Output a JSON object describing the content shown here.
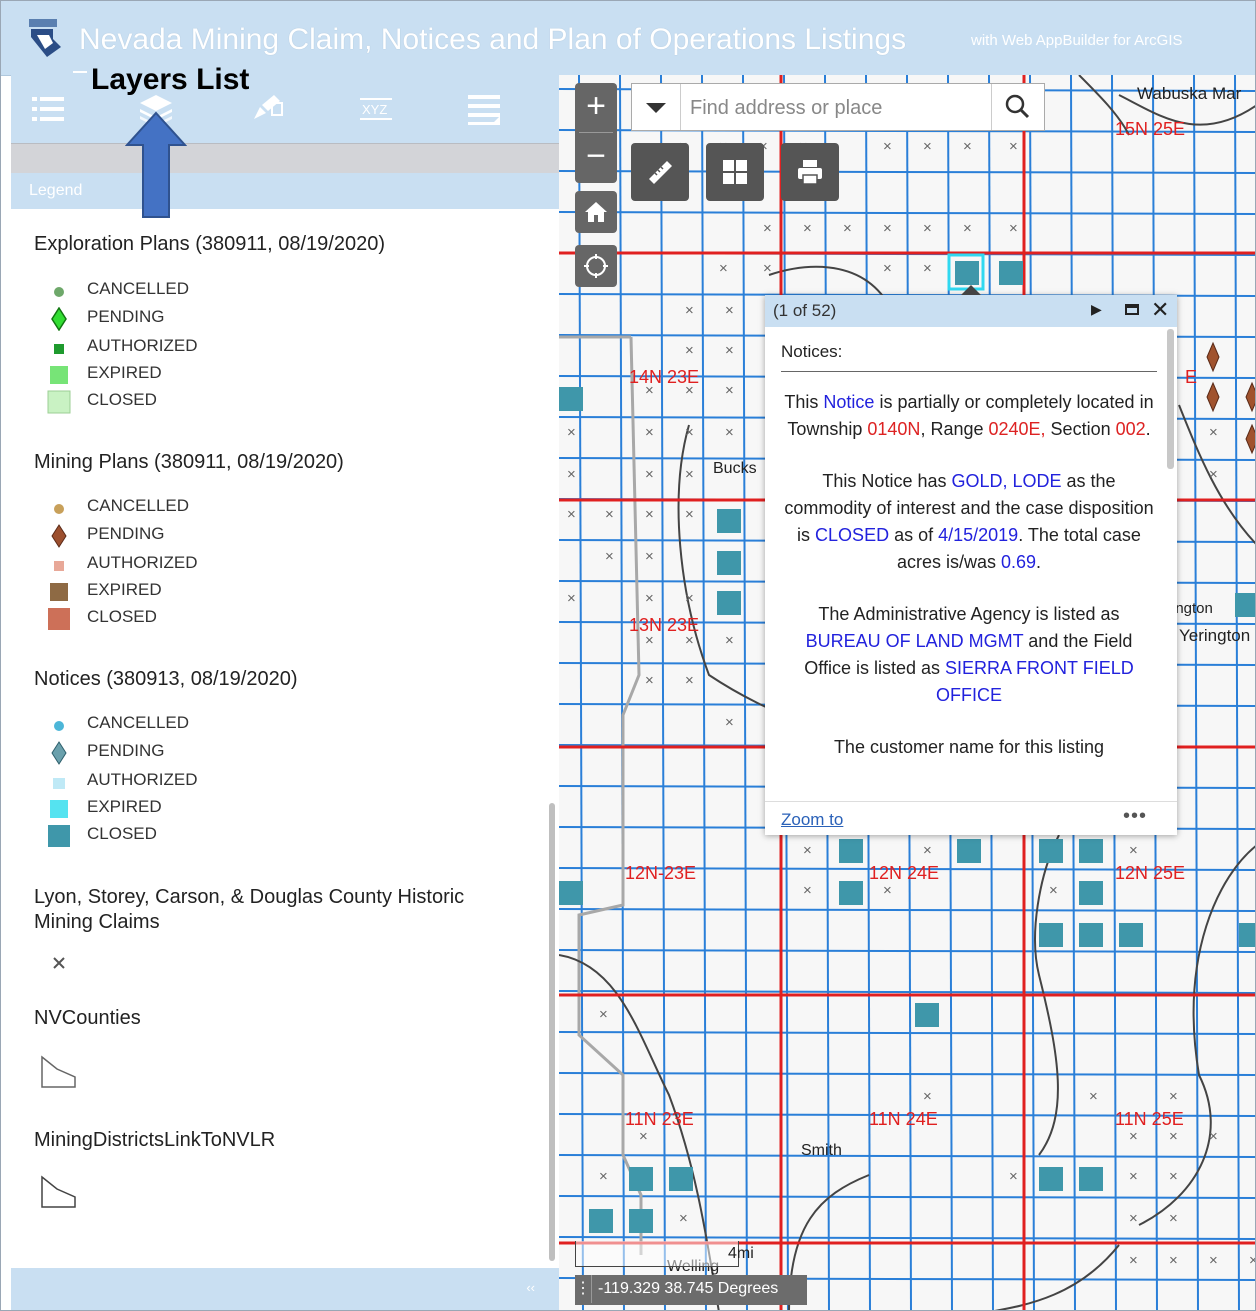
{
  "header": {
    "title": "Nevada Mining Claim, Notices and Plan of Operations Listings",
    "subtitle": "with Web AppBuilder for ArcGIS"
  },
  "annotation": {
    "label": "Layers List"
  },
  "panel": {
    "tools": [
      "list-icon",
      "layers-icon",
      "edit-icon",
      "xyz-coordinate-icon",
      "menu-list-icon"
    ],
    "tab_label": "Legend",
    "collapse_symbol": "‹‹"
  },
  "legend": {
    "exploration": {
      "title": "Exploration Plans (380911, 08/19/2020)",
      "items": [
        "CANCELLED",
        "PENDING",
        "AUTHORIZED",
        "EXPIRED",
        "CLOSED"
      ]
    },
    "mining": {
      "title": "Mining Plans (380911, 08/19/2020)",
      "items": [
        "CANCELLED",
        "PENDING",
        "AUTHORIZED",
        "EXPIRED",
        "CLOSED"
      ]
    },
    "notices": {
      "title": "Notices (380913, 08/19/2020)",
      "items": [
        "CANCELLED",
        "PENDING",
        "AUTHORIZED",
        "EXPIRED",
        "CLOSED"
      ]
    },
    "historic": {
      "title": "Lyon, Storey, Carson, & Douglas County Historic Mining Claims"
    },
    "counties": {
      "title": "NVCounties"
    },
    "districts": {
      "title": "MiningDistrictsLinkToNVLR"
    }
  },
  "colors": {
    "header": "#c9dff2",
    "grid_blue": "#2a7fd8",
    "township_red": "#e02020",
    "notice_teal": "#3f97aa",
    "mining_brown": "#a0522d"
  },
  "map": {
    "search_placeholder": "Find address or place",
    "zoom_in": "+",
    "zoom_out": "−",
    "labels": {
      "wabuska": "Wabuska Mar",
      "t15n25e": "15N 25E",
      "t14n23e": "14N 23E",
      "bucks": "Bucks",
      "t13n23e": "13N 23E",
      "yerington_small": "rington",
      "yerington": "Yerington",
      "t12n23e": "12N-23E",
      "t12n24e": "12N 24E",
      "t12n25e": "12N 25E",
      "t11n23e": "11N 23E",
      "t11n24e": "11N 24E",
      "t11n25e": "11N 25E",
      "smith": "Smith",
      "wellington": "Welling",
      "partial_e": "E"
    },
    "scale_label": "4mi",
    "coordinates": "-119.329 38.745 Degrees"
  },
  "popup": {
    "count": "(1 of 52)",
    "title": "Notices:",
    "p1": {
      "a": "This ",
      "b": "Notice",
      "c": " is partially or completely located in Township ",
      "d": "0140N",
      "e": ", Range ",
      "f": "0240E,",
      "g": " Section ",
      "h": "002",
      "i": "."
    },
    "p2": {
      "a": "This Notice has ",
      "b": "GOLD, LODE",
      "c": " as the commodity of interest and the case disposition is ",
      "d": "CLOSED",
      "e": " as of ",
      "f": "4/15/2019",
      "g": ". The total case acres is/was ",
      "h": "0.69",
      "i": "."
    },
    "p3": {
      "a": "The Administrative Agency is listed as ",
      "b": "BUREAU OF LAND MGMT",
      "c": " and the Field Office is listed as ",
      "d": "SIERRA FRONT FIELD OFFICE"
    },
    "p4": "The customer name for this listing",
    "zoom_to": "Zoom to",
    "more": "•••"
  }
}
